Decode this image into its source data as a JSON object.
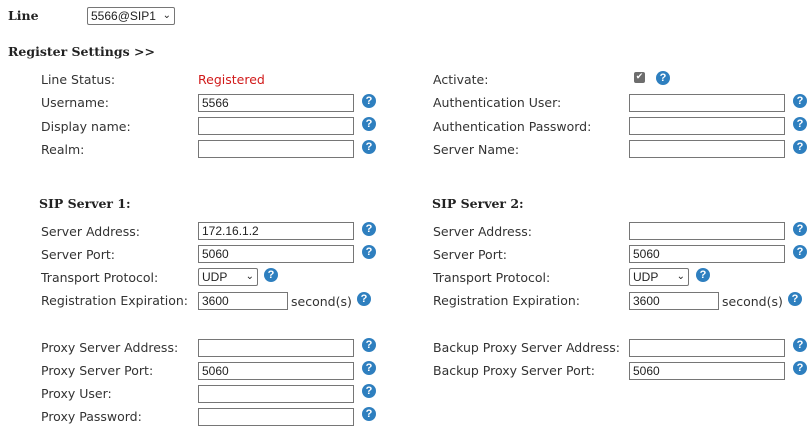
{
  "line": {
    "label": "Line",
    "selected": "5566@SIP1"
  },
  "register_settings": {
    "title": "Register Settings >>",
    "line_status_label": "Line Status:",
    "line_status_value": "Registered",
    "activate_label": "Activate:",
    "activate_checked": true,
    "username_label": "Username:",
    "username_value": "5566",
    "auth_user_label": "Authentication User:",
    "auth_user_value": "",
    "display_name_label": "Display name:",
    "display_name_value": "",
    "auth_password_label": "Authentication Password:",
    "auth_password_value": "",
    "realm_label": "Realm:",
    "realm_value": "",
    "server_name_label": "Server Name:",
    "server_name_value": ""
  },
  "sip_server_1": {
    "title": "SIP Server 1:",
    "address_label": "Server Address:",
    "address_value": "172.16.1.2",
    "port_label": "Server Port:",
    "port_value": "5060",
    "transport_label": "Transport Protocol:",
    "transport_value": "UDP",
    "expiration_label": "Registration Expiration:",
    "expiration_value": "3600",
    "expiration_unit": "second(s)"
  },
  "sip_server_2": {
    "title": "SIP Server 2:",
    "address_label": "Server Address:",
    "address_value": "",
    "port_label": "Server Port:",
    "port_value": "5060",
    "transport_label": "Transport Protocol:",
    "transport_value": "UDP",
    "expiration_label": "Registration Expiration:",
    "expiration_value": "3600",
    "expiration_unit": "second(s)"
  },
  "proxy": {
    "address_label": "Proxy Server Address:",
    "address_value": "",
    "port_label": "Proxy Server Port:",
    "port_value": "5060",
    "user_label": "Proxy User:",
    "user_value": "",
    "password_label": "Proxy Password:",
    "password_value": "",
    "backup_address_label": "Backup Proxy Server Address:",
    "backup_address_value": "",
    "backup_port_label": "Backup Proxy Server Port:",
    "backup_port_value": "5060"
  },
  "help_glyph": "?",
  "select_arrow": "⌄",
  "check_glyph": "✔",
  "accent_color": "#2e7fbf",
  "status_color": "#d11a1a"
}
